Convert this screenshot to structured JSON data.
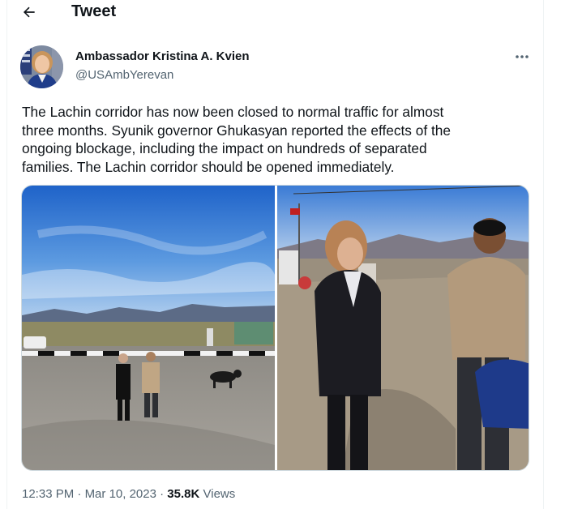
{
  "header": {
    "title": "Tweet",
    "back_icon": "arrow-left-icon"
  },
  "tweet": {
    "author_name": "Ambassador Kristina A. Kvien",
    "author_handle": "@USAmbYerevan",
    "more_icon": "more-horizontal-icon",
    "text_lines": [
      "The Lachin corridor has now been closed to normal traffic for almost",
      "three months.  Syunik governor Ghukasyan reported the effects of the",
      "ongoing blockage, including the impact on hundreds of separated",
      "families. The Lachin corridor should be opened immediately."
    ],
    "time": "12:33 PM",
    "date": "Mar 10, 2023",
    "separator": "·",
    "views_count": "35.8K",
    "views_label": "Views"
  },
  "colors": {
    "text_primary": "#0f1419",
    "text_secondary": "#536471",
    "border": "#cfd9de"
  }
}
